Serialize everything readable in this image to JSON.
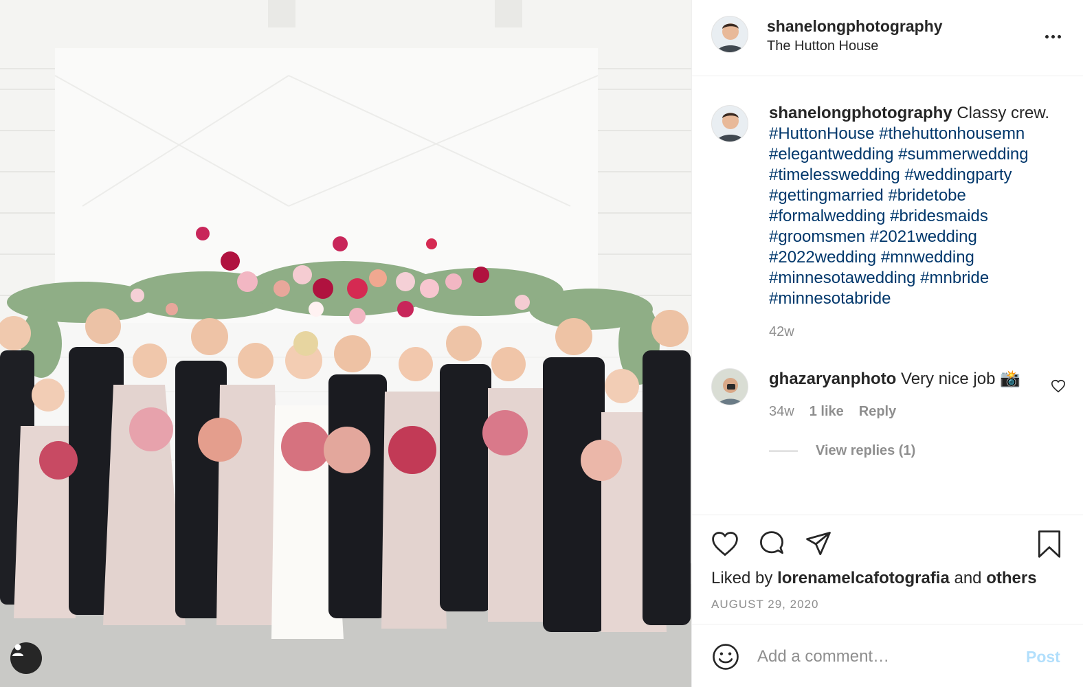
{
  "post": {
    "author": "shanelongphotography",
    "location": "The Hutton House"
  },
  "caption": {
    "username": "shanelongphotography",
    "text": "Classy crew.",
    "hashtags": [
      "#HuttonHouse",
      "#thehuttonhousemn",
      "#elegantwedding",
      "#summerwedding",
      "#timelesswedding",
      "#weddingparty",
      "#gettingmarried",
      "#bridetobe",
      "#formalwedding",
      "#bridesmaids",
      "#groomsmen",
      "#2021wedding",
      "#2022wedding",
      "#mnwedding",
      "#minnesotawedding",
      "#mnbride",
      "#minnesotabride"
    ],
    "time": "42w"
  },
  "comment": {
    "username": "ghazaryanphoto",
    "text": "Very nice job 📸",
    "time": "34w",
    "likes": "1 like",
    "reply_label": "Reply",
    "view_replies": "View replies (1)"
  },
  "actions": {
    "liked_prefix": "Liked by",
    "liked_user": "lorenamelcafotografia",
    "liked_and": "and",
    "liked_others": "others",
    "date": "AUGUST 29, 2020"
  },
  "comment_box": {
    "placeholder": "Add a comment…",
    "post_label": "Post"
  },
  "icons": {
    "more": "more-options-icon",
    "like": "heart-icon",
    "comment": "comment-icon",
    "share": "share-icon",
    "save": "bookmark-icon",
    "emoji": "emoji-icon",
    "tags": "user-tag-icon"
  },
  "colors": {
    "hashtag": "#00376b",
    "secondary": "#8e8e8e",
    "post_disabled": "#b2dffc"
  }
}
